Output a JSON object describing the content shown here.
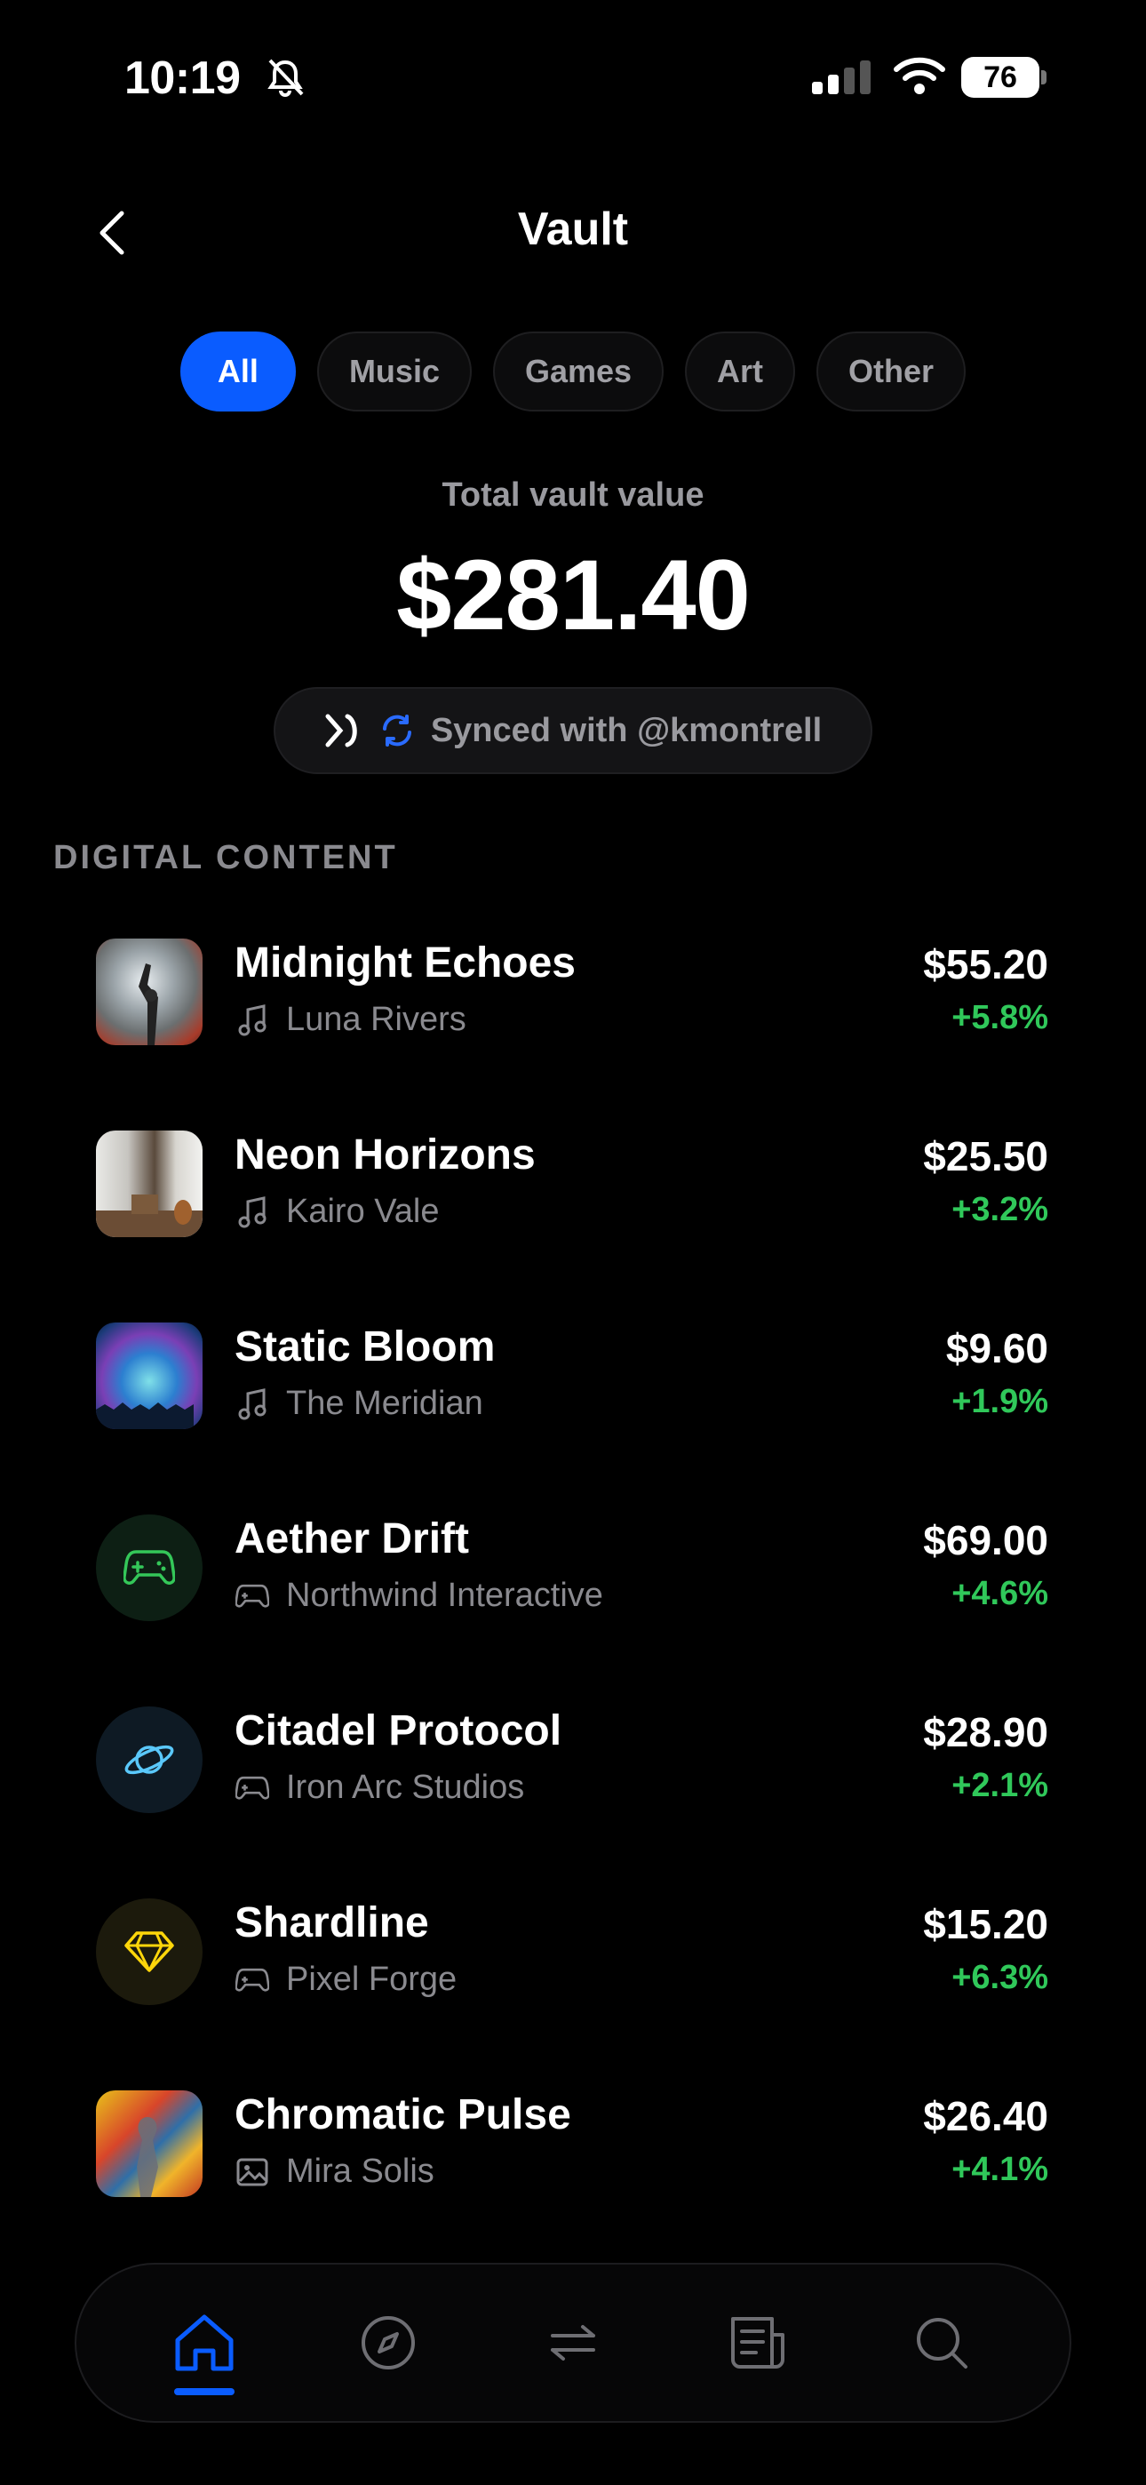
{
  "status_bar": {
    "time": "10:19",
    "battery": "76"
  },
  "header": {
    "title": "Vault"
  },
  "filters": [
    {
      "label": "All",
      "active": true
    },
    {
      "label": "Music",
      "active": false
    },
    {
      "label": "Games",
      "active": false
    },
    {
      "label": "Art",
      "active": false
    },
    {
      "label": "Other",
      "active": false
    }
  ],
  "summary": {
    "label": "Total vault value",
    "value": "$281.40",
    "sync_text": "Synced with @kmontrell"
  },
  "section": {
    "title": "DIGITAL CONTENT"
  },
  "items": [
    {
      "title": "Midnight Echoes",
      "creator": "Luna Rivers",
      "category_icon": "music-note-icon",
      "price": "$55.20",
      "change": "+5.8%"
    },
    {
      "title": "Neon Horizons",
      "creator": "Kairo Vale",
      "category_icon": "music-note-icon",
      "price": "$25.50",
      "change": "+3.2%"
    },
    {
      "title": "Static Bloom",
      "creator": "The Meridian",
      "category_icon": "music-note-icon",
      "price": "$9.60",
      "change": "+1.9%"
    },
    {
      "title": "Aether Drift",
      "creator": "Northwind Interactive",
      "category_icon": "gamepad-icon",
      "price": "$69.00",
      "change": "+4.6%"
    },
    {
      "title": "Citadel Protocol",
      "creator": "Iron Arc Studios",
      "category_icon": "gamepad-icon",
      "price": "$28.90",
      "change": "+2.1%"
    },
    {
      "title": "Shardline",
      "creator": "Pixel Forge",
      "category_icon": "gamepad-icon",
      "price": "$15.20",
      "change": "+6.3%"
    },
    {
      "title": "Chromatic Pulse",
      "creator": "Mira Solis",
      "category_icon": "image-icon",
      "price": "$26.40",
      "change": "+4.1%"
    }
  ],
  "tab_bar": [
    {
      "icon": "home-icon",
      "active": true
    },
    {
      "icon": "compass-icon",
      "active": false
    },
    {
      "icon": "swap-arrows-icon",
      "active": false
    },
    {
      "icon": "news-icon",
      "active": false
    },
    {
      "icon": "search-icon",
      "active": false
    }
  ],
  "colors": {
    "accent": "#0a5cff",
    "positive": "#30c85a",
    "muted": "#8a8a8f",
    "background": "#000000"
  }
}
